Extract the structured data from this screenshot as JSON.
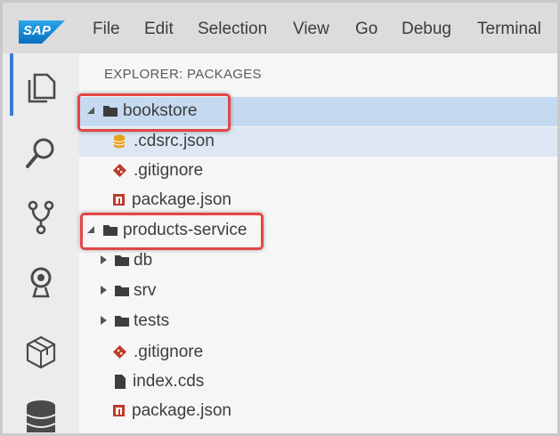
{
  "menubar": {
    "logo_text": "SAP",
    "items": [
      "File",
      "Edit",
      "Selection",
      "View",
      "Go",
      "Debug",
      "Terminal"
    ]
  },
  "activity_bar": {
    "icons": [
      "explorer-icon",
      "search-icon",
      "source-control-icon",
      "debug-icon",
      "extensions-icon",
      "database-icon"
    ]
  },
  "explorer": {
    "title": "EXPLORER: PACKAGES",
    "tree": [
      {
        "label": "bookstore",
        "kind": "folder",
        "expanded": true
      },
      {
        "label": ".cdsrc.json",
        "kind": "db-file"
      },
      {
        "label": ".gitignore",
        "kind": "git-file"
      },
      {
        "label": "package.json",
        "kind": "npm-file"
      },
      {
        "label": "products-service",
        "kind": "folder",
        "expanded": true
      },
      {
        "label": "db",
        "kind": "folder",
        "expanded": false
      },
      {
        "label": "srv",
        "kind": "folder",
        "expanded": false
      },
      {
        "label": "tests",
        "kind": "folder",
        "expanded": false
      },
      {
        "label": ".gitignore",
        "kind": "git-file"
      },
      {
        "label": "index.cds",
        "kind": "file"
      },
      {
        "label": "package.json",
        "kind": "npm-file"
      }
    ]
  },
  "colors": {
    "accent": "#3a7bd5",
    "selection": "#c5daf0",
    "callout": "#e64545",
    "git_icon": "#c0392b",
    "db_icon": "#e8a020"
  }
}
